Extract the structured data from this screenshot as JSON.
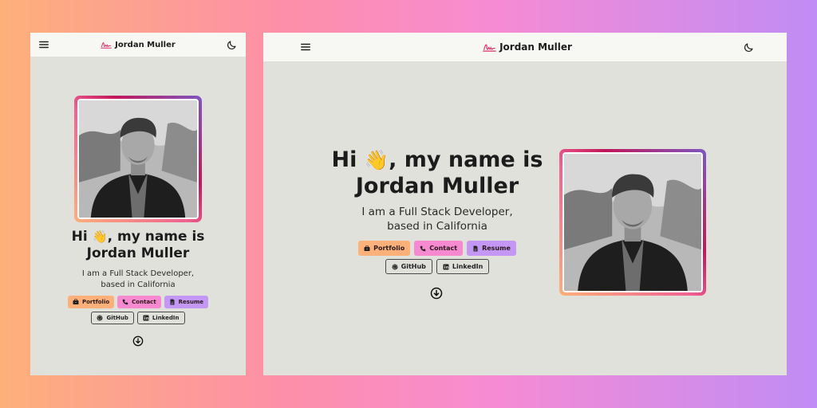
{
  "brand": {
    "name": "Jordan Muller",
    "logo_icon": "signature-icon",
    "accent": "#e91e63"
  },
  "nav": {
    "menu_icon": "hamburger-menu-icon",
    "theme_icon": "moon-icon"
  },
  "hero": {
    "greeting_prefix": "Hi",
    "wave": "👋",
    "greeting_suffix": ", my name is",
    "name": "Jordan Muller",
    "subtitle_line1": "I am a Full Stack Developer,",
    "subtitle_line2": "based in California",
    "photo": "profile-photo"
  },
  "buttons": {
    "portfolio": "Portfolio",
    "contact": "Contact",
    "resume": "Resume",
    "github": "GitHub",
    "linkedin": "LinkedIn"
  },
  "colors": {
    "portfolio": "#fdb07a",
    "contact": "#f789d1",
    "resume": "#c597f5",
    "frame_bg": "#e1e1dc",
    "navbar_bg": "#f7f7f4"
  },
  "scroll_icon": "arrow-down-circle-icon"
}
